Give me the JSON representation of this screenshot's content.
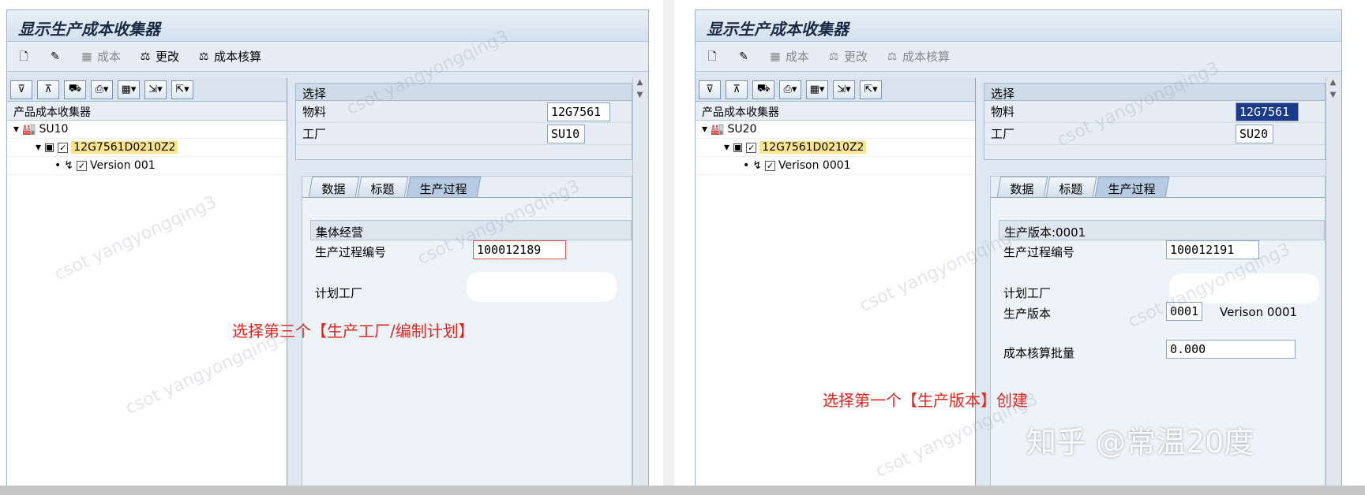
{
  "left": {
    "title": "显示生产成本收集器",
    "toolbar": {
      "cost": "成本",
      "change": "更改",
      "costing": "成本核算"
    },
    "tree": {
      "header": "产品成本收集器",
      "plant": "SU10",
      "material": "12G7561D0210Z2",
      "version": "Version 001"
    },
    "selection": {
      "title": "选择",
      "material_label": "物料",
      "material_value": "12G7561",
      "plant_label": "工厂",
      "plant_value": "SU10"
    },
    "tabs": [
      "数据",
      "标题",
      "生产过程"
    ],
    "content": {
      "group": "集体经营",
      "process_no_label": "生产过程编号",
      "process_no_value": "100012189",
      "planning_plant_label": "计划工厂"
    },
    "annotation": "选择第三个【生产工厂/编制计划】"
  },
  "right": {
    "title": "显示生产成本收集器",
    "toolbar": {
      "cost": "成本",
      "change": "更改",
      "costing": "成本核算"
    },
    "tree": {
      "header": "产品成本收集器",
      "plant": "SU20",
      "material": "12G7561D0210Z2",
      "version": "Verison 0001"
    },
    "selection": {
      "title": "选择",
      "material_label": "物料",
      "material_value": "12G7561",
      "plant_label": "工厂",
      "plant_value": "SU20"
    },
    "tabs": [
      "数据",
      "标题",
      "生产过程"
    ],
    "content": {
      "group": "生产版本:0001",
      "process_no_label": "生产过程编号",
      "process_no_value": "100012191",
      "planning_plant_label": "计划工厂",
      "version_label": "生产版本",
      "version_value": "0001",
      "version_text": "Verison 0001",
      "lot_label": "成本核算批量",
      "lot_value": "0.000"
    },
    "annotation": "选择第一个【生产版本】创建"
  },
  "watermark": "csot yangyongqing3",
  "brand": "知乎 @常温20度"
}
